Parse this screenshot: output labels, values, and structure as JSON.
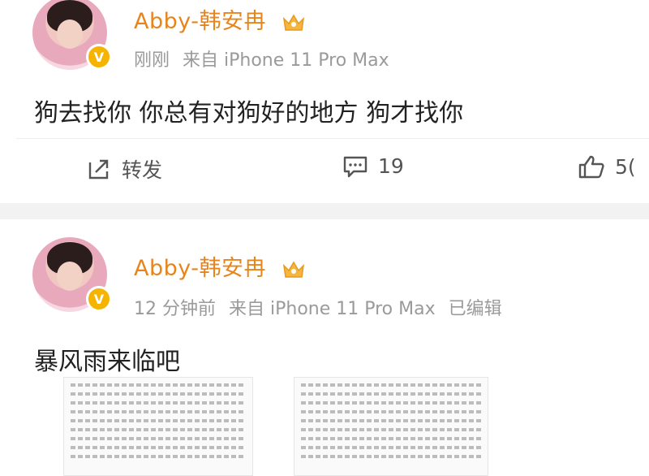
{
  "posts": [
    {
      "username": "Abby-韩安冉",
      "time": "刚刚",
      "source": "来自 iPhone 11 Pro Max",
      "edited": "",
      "text": "狗去找你 你总有对狗好的地方 狗才找你",
      "actions": {
        "repost": "转发",
        "comments": "19",
        "likes": "5("
      }
    },
    {
      "username": "Abby-韩安冉",
      "time": "12 分钟前",
      "source": "来自 iPhone 11 Pro Max",
      "edited": "已编辑",
      "text": "暴风雨来临吧"
    }
  ],
  "colors": {
    "username": "#e8841c",
    "meta": "#9a9a9a",
    "vip": "#f5b400",
    "separator": "#f2f2f2"
  },
  "icons": [
    "crown-icon",
    "verified-v-icon",
    "repost-icon",
    "comment-icon",
    "like-icon"
  ]
}
